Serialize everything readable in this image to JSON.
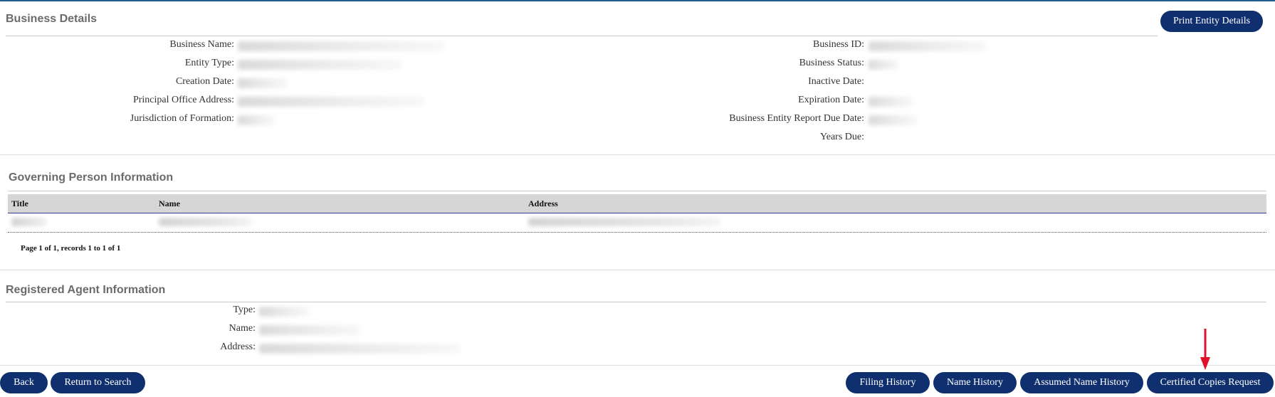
{
  "header": {
    "title": "Business Details",
    "print_button": "Print Entity Details"
  },
  "business_details": {
    "left_fields": [
      {
        "label": "Business Name:"
      },
      {
        "label": "Entity Type:"
      },
      {
        "label": "Creation Date:"
      },
      {
        "label": "Principal Office Address:"
      },
      {
        "label": "Jurisdiction of Formation:"
      }
    ],
    "right_fields": [
      {
        "label": "Business ID:"
      },
      {
        "label": "Business Status:"
      },
      {
        "label": "Inactive Date:"
      },
      {
        "label": "Expiration Date:"
      },
      {
        "label": "Business Entity Report Due Date:"
      },
      {
        "label": "Years Due:"
      }
    ]
  },
  "governing_person": {
    "title": "Governing Person Information",
    "columns": [
      "Title",
      "Name",
      "Address"
    ],
    "pager": "Page 1 of 1, records 1 to 1 of 1"
  },
  "registered_agent": {
    "title": "Registered Agent Information",
    "fields": [
      {
        "label": "Type:"
      },
      {
        "label": "Name:"
      },
      {
        "label": "Address:"
      }
    ]
  },
  "footer": {
    "back": "Back",
    "return_to_search": "Return to Search",
    "filing_history": "Filing History",
    "name_history": "Name History",
    "assumed_name_history": "Assumed Name History",
    "certified_copies_request": "Certified Copies Request"
  },
  "colors": {
    "button_bg": "#0f2f6e",
    "arrow": "#e0112b",
    "section_title": "#6b6b6b"
  }
}
